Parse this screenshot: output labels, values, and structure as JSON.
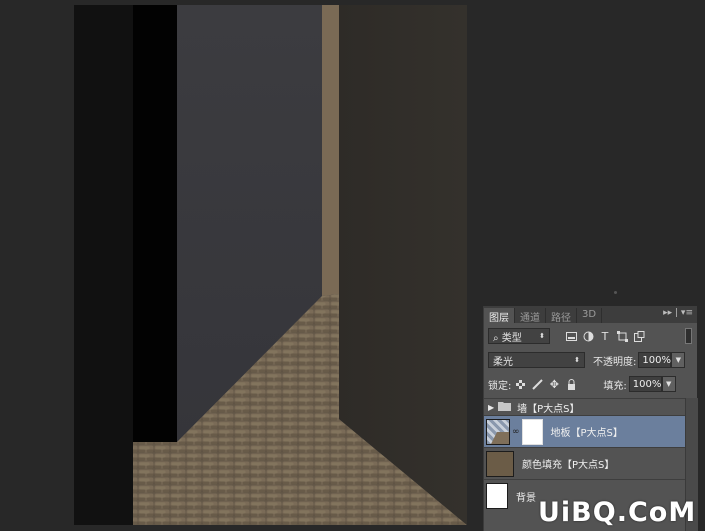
{
  "layers_panel": {
    "tabs": [
      "图层",
      "通道",
      "路径",
      "3D"
    ],
    "active_tab": 0,
    "panel_menu_glyph": "▸▸ | ▾≡",
    "filter_kind": "类型",
    "blend_mode": "柔光",
    "opacity_label": "不透明度:",
    "opacity_value": "100%",
    "lock_label": "锁定:",
    "fill_label": "填充:",
    "fill_value": "100%",
    "layers": [
      {
        "name": "墙【P大点S】",
        "type": "group",
        "expanded": false,
        "selected": false
      },
      {
        "name": "地板【P大点S】",
        "type": "image-with-mask",
        "selected": true
      },
      {
        "name": "颜色填充【P大点S】",
        "type": "color-fill",
        "color": "#6b5c47",
        "selected": false
      },
      {
        "name": "背景",
        "type": "background",
        "color": "#ffffff",
        "selected": false
      }
    ]
  },
  "watermark": {
    "text": "UiBQ.CoM"
  },
  "colors": {
    "workspace": "#282828",
    "panel": "#535353",
    "selected_layer": "#6b7f9d",
    "left_wall": "#3a3a3d",
    "right_wall": "#2f2c28",
    "sky_gap": "#7a6a55",
    "floor": "#6e6150"
  }
}
